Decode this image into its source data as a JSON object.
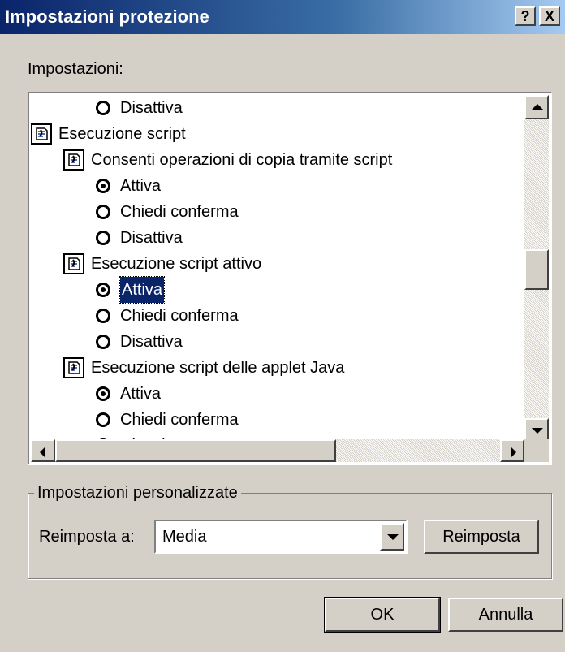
{
  "window": {
    "title": "Impostazioni protezione",
    "help_label": "?",
    "close_label": "X"
  },
  "settings_label": "Impostazioni:",
  "list": {
    "items": [
      {
        "type": "radio",
        "label": "Disattiva",
        "checked": false,
        "level": 2
      },
      {
        "type": "category",
        "label": "Esecuzione script",
        "level": 0
      },
      {
        "type": "setting",
        "label": "Consenti operazioni di copia tramite script",
        "level": 1
      },
      {
        "type": "radio",
        "label": "Attiva",
        "checked": true,
        "level": 2
      },
      {
        "type": "radio",
        "label": "Chiedi conferma",
        "checked": false,
        "level": 2
      },
      {
        "type": "radio",
        "label": "Disattiva",
        "checked": false,
        "level": 2
      },
      {
        "type": "setting",
        "label": "Esecuzione script attivo",
        "level": 1
      },
      {
        "type": "radio",
        "label": "Attiva",
        "checked": true,
        "selected": true,
        "level": 2
      },
      {
        "type": "radio",
        "label": "Chiedi conferma",
        "checked": false,
        "level": 2
      },
      {
        "type": "radio",
        "label": "Disattiva",
        "checked": false,
        "level": 2
      },
      {
        "type": "setting",
        "label": "Esecuzione script delle applet Java",
        "level": 1
      },
      {
        "type": "radio",
        "label": "Attiva",
        "checked": true,
        "level": 2
      },
      {
        "type": "radio",
        "label": "Chiedi conferma",
        "checked": false,
        "level": 2
      },
      {
        "type": "radio",
        "label": "Disattiva",
        "checked": false,
        "level": 2
      }
    ]
  },
  "custom_group": {
    "legend": "Impostazioni personalizzate",
    "reset_to_label": "Reimposta a:",
    "combo_value": "Media",
    "reset_button": "Reimposta"
  },
  "buttons": {
    "ok": "OK",
    "cancel": "Annulla"
  },
  "colors": {
    "face": "#d4d0c8",
    "title_start": "#0a246a",
    "title_end": "#a6caf0",
    "selection": "#0a246a"
  }
}
